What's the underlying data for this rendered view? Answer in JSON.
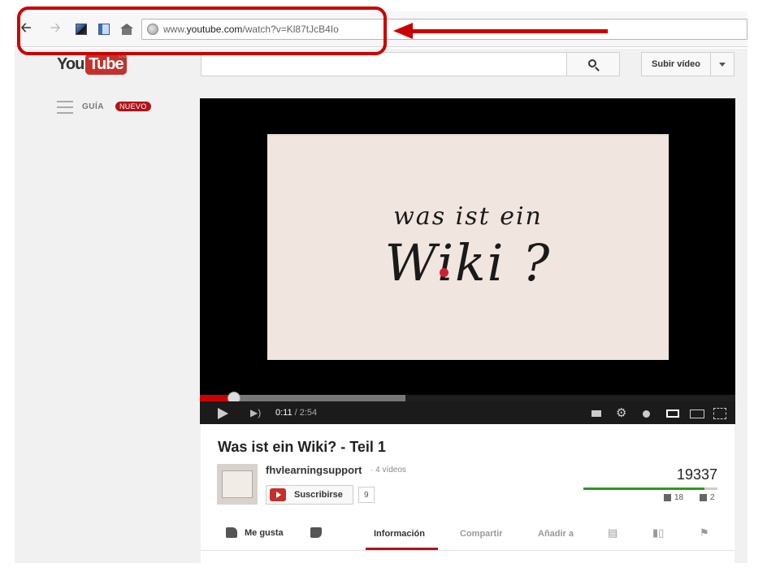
{
  "browser": {
    "url_prefix": "www.",
    "url_domain": "youtube.com",
    "url_path": "/watch?v=Kl87tJcB4Io"
  },
  "youtube": {
    "logo_you": "You",
    "logo_tube": "Tube",
    "logo_country": "DE",
    "upload_label": "Subir vídeo",
    "guide_label": "GUÍA",
    "new_badge": "NUEVO"
  },
  "player": {
    "frame_text_line1": "was ist ein",
    "frame_text_line2": "Wiki ?",
    "current_time": "0:11",
    "duration": " / 2:54",
    "progress_fraction": 0.063
  },
  "video": {
    "title": "Was ist ein Wiki? - Teil 1",
    "channel": "fhvlearningsupport",
    "video_count": "· 4 vídeos",
    "subscribe_label": "Suscribirse",
    "subscriber_count": "9",
    "views": "19337",
    "likes": "18",
    "dislikes": "2",
    "like_fraction": 0.9
  },
  "actions": {
    "like_label": "Me gusta",
    "tabs": [
      "Información",
      "Compartir",
      "Añadir a"
    ]
  },
  "colors": {
    "annotation": "#cc0000",
    "brand_red": "#c4302b",
    "like_green": "#2b9a1e"
  }
}
